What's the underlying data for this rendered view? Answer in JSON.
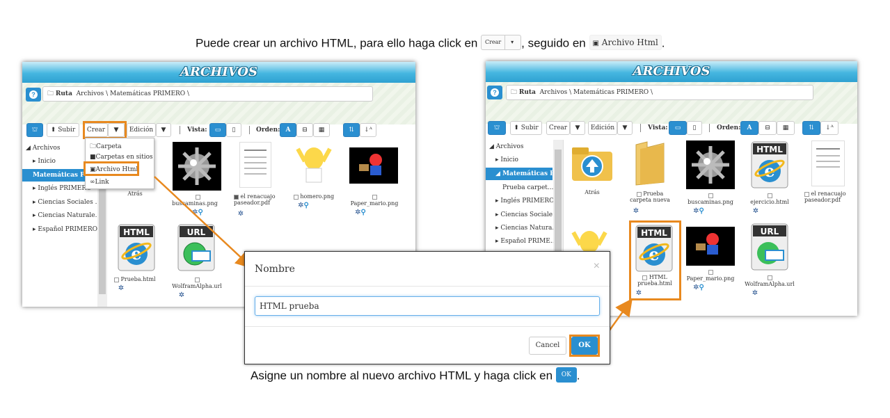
{
  "captions": {
    "top_pre": "Puede crear un archivo HTML, para ello haga click en",
    "top_btn": "Crear",
    "top_mid": ", seguido en",
    "top_html": "Archivo Html",
    "top_end": ".",
    "bottom_pre": "Asigne un nombre al nuevo archivo HTML y haga click en",
    "bottom_btn": "OK",
    "bottom_end": "."
  },
  "left_panel": {
    "title": "ARCHIVOS",
    "route_label": "Ruta",
    "route_path": "Archivos \\ Matemáticas PRIMERO \\",
    "toolbar": {
      "subir": "Subir",
      "crear": "Crear",
      "edicion": "Edición",
      "vista": "Vista:",
      "orden": "Orden:",
      "orden_a": "A"
    },
    "menu": [
      "Carpeta",
      "Carpetas en sitios",
      "Archivo Html",
      "Link"
    ],
    "tree": [
      "Archivos",
      "Inicio",
      "Matemáticas PRI",
      "Inglés PRIMERO",
      "Ciencias Sociales ...",
      "Ciencias Naturale...",
      "Español PRIMERO"
    ],
    "files": {
      "atras": "Atrás",
      "buscaminas": "buscaminas.png",
      "renacuajo": "el renacuajo paseador.pdf",
      "homero": "homero.png",
      "paper": "Paper_mario.png",
      "prueba": "Prueba.html",
      "wolfram": "WolframAlpha.url"
    }
  },
  "right_panel": {
    "title": "ARCHIVOS",
    "route_label": "Ruta",
    "route_path": "Archivos \\ Matemáticas PRIMERO \\",
    "toolbar": {
      "subir": "Subir",
      "crear": "Crear",
      "edicion": "Edición",
      "vista": "Vista:",
      "orden": "Orden:",
      "orden_a": "A"
    },
    "tree": [
      "Archivos",
      "Inicio",
      "Matemáticas P...",
      "Prueba carpet...",
      "Inglés PRIMERO",
      "Ciencias Sociale...",
      "Ciencias Natura...",
      "Español PRIME..."
    ],
    "files": {
      "atras": "Atrás",
      "carpeta": "Prueba carpeta nueva",
      "buscaminas": "buscaminas.png",
      "ejercicio": "ejercicio.html",
      "renacuajo": "el renacuajo paseador.pdf",
      "html_prueba": "HTML prueba.html",
      "paper": "Paper_mario.png",
      "wolfram": "WolframAlpha.url"
    }
  },
  "dialog": {
    "title": "Nombre",
    "close": "×",
    "input_value": "HTML prueba",
    "cancel": "Cancel",
    "ok": "OK"
  },
  "colors": {
    "accent": "#2a8fd0",
    "highlight": "#e8891f"
  }
}
